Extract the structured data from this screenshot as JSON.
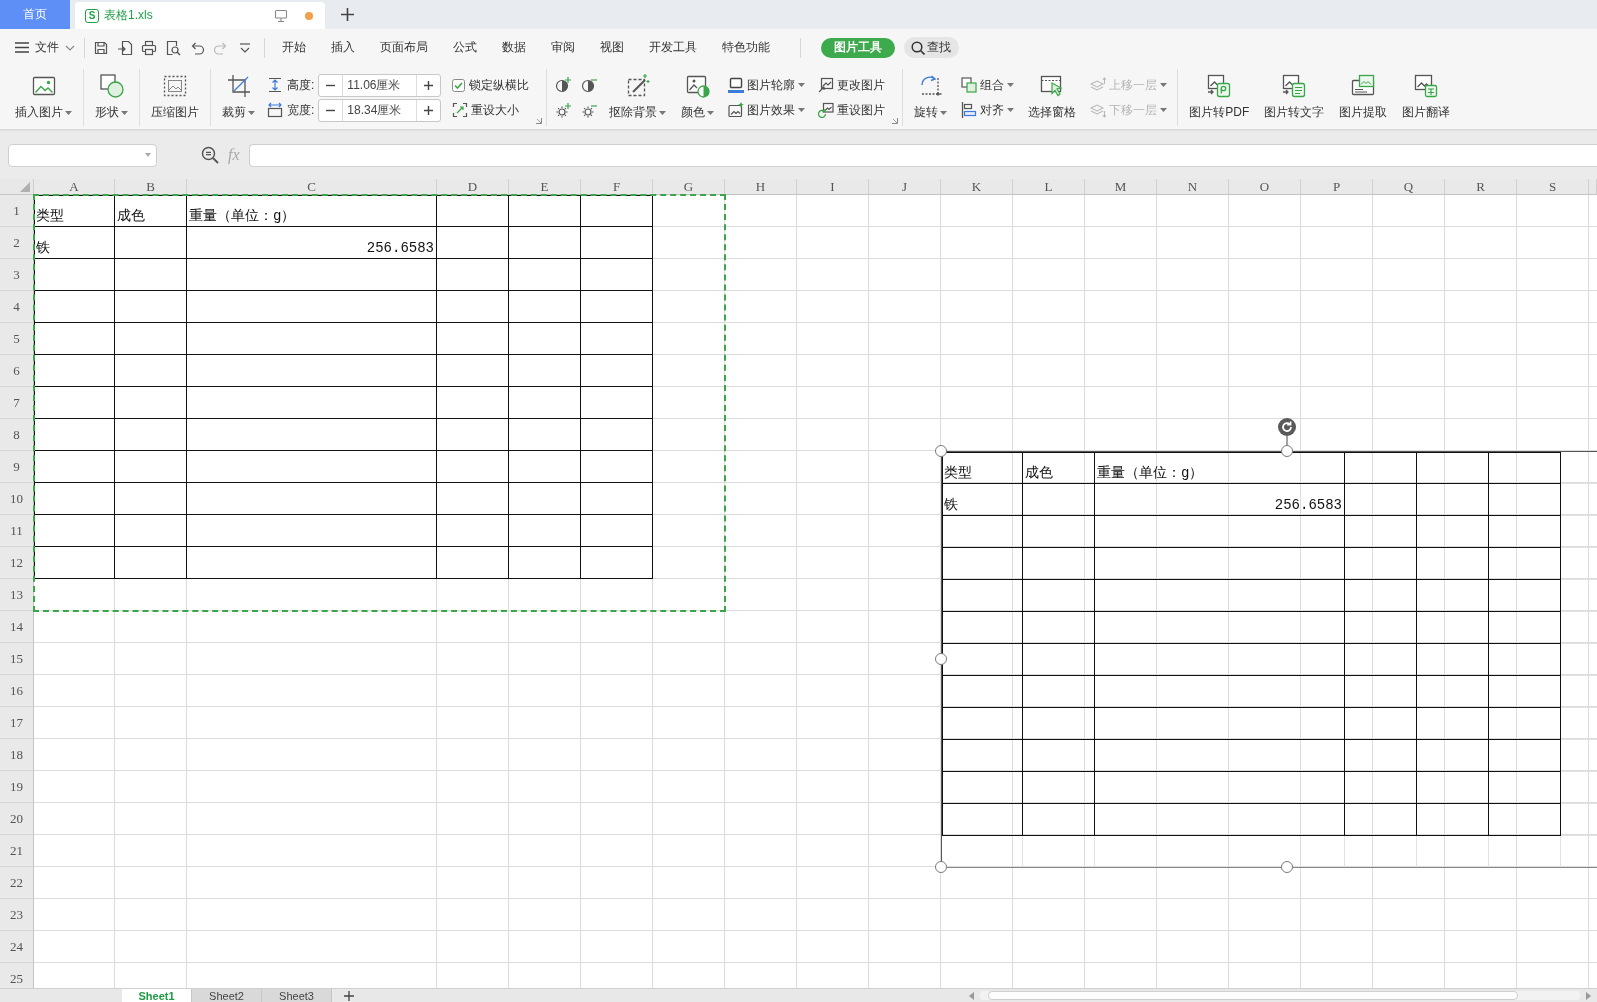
{
  "window_tabs": [
    {
      "kind": "home",
      "label": "首页",
      "selected": false
    },
    {
      "kind": "document",
      "logo": "S",
      "label": "表格1.xls",
      "selected": true,
      "unsaved": true
    }
  ],
  "menu": {
    "file": "文件",
    "quick_access": [
      {
        "disabled": false
      },
      {
        "disabled": false
      },
      {
        "disabled": false
      },
      {
        "disabled": false
      },
      {
        "disabled": false
      },
      {
        "disabled": true
      },
      {
        "disabled": false
      }
    ],
    "tabs": [
      {
        "kind": "standard",
        "label": "开始",
        "selected": false
      },
      {
        "kind": "standard",
        "label": "插入",
        "selected": false
      },
      {
        "kind": "standard",
        "label": "页面布局",
        "selected": false
      },
      {
        "kind": "standard",
        "label": "公式",
        "selected": false
      },
      {
        "kind": "standard",
        "label": "数据",
        "selected": false
      },
      {
        "kind": "standard",
        "label": "审阅",
        "selected": false
      },
      {
        "kind": "standard",
        "label": "视图",
        "selected": false
      },
      {
        "kind": "standard",
        "label": "开发工具",
        "selected": false
      },
      {
        "kind": "standard",
        "label": "特色功能",
        "selected": false
      },
      {
        "kind": "contextual",
        "label": "图片工具",
        "selected": true
      }
    ],
    "search": "查找"
  },
  "ribbon": [
    {
      "items": [
        {
          "kind": "large",
          "label": "插入图片",
          "dropdown": true,
          "disabled": false
        }
      ]
    },
    {
      "items": [
        {
          "kind": "large",
          "label": "形状",
          "dropdown": true,
          "disabled": false
        }
      ]
    },
    {
      "items": [
        {
          "kind": "large",
          "label": "压缩图片",
          "dropdown": false,
          "disabled": false
        }
      ]
    },
    {
      "launcher": true,
      "items": [
        {
          "kind": "large",
          "label": "裁剪",
          "dropdown": true,
          "disabled": false
        },
        {
          "kind": "size",
          "fields": [
            {
              "label": "高度:",
              "value": "11.06厘米"
            },
            {
              "label": "宽度:",
              "value": "18.34厘米"
            }
          ]
        },
        {
          "kind": "stack",
          "entries": [
            {
              "kind": "check",
              "label": "锁定纵横比",
              "checked": true,
              "disabled": false
            },
            {
              "kind": "small",
              "label": "重设大小",
              "dropdown": false,
              "disabled": false
            }
          ]
        }
      ]
    },
    {
      "launcher": true,
      "items": [
        {
          "kind": "icon_grid",
          "buttons": [
            {
              "disabled": false
            },
            {
              "disabled": false
            },
            {
              "disabled": false
            },
            {
              "disabled": false
            }
          ]
        },
        {
          "kind": "large",
          "label": "抠除背景",
          "dropdown": true,
          "disabled": false
        },
        {
          "kind": "large",
          "label": "颜色",
          "dropdown": true,
          "disabled": false
        },
        {
          "kind": "stack",
          "entries": [
            {
              "kind": "small",
              "label": "图片轮廓",
              "dropdown": true,
              "disabled": false
            },
            {
              "kind": "small",
              "label": "图片效果",
              "dropdown": true,
              "disabled": false
            }
          ]
        },
        {
          "kind": "stack",
          "entries": [
            {
              "kind": "small",
              "label": "更改图片",
              "dropdown": false,
              "disabled": false
            },
            {
              "kind": "small",
              "label": "重设图片",
              "dropdown": false,
              "disabled": false
            }
          ]
        }
      ]
    },
    {
      "items": [
        {
          "kind": "large",
          "label": "旋转",
          "dropdown": true,
          "disabled": false
        },
        {
          "kind": "stack",
          "entries": [
            {
              "kind": "small",
              "label": "组合",
              "dropdown": true,
              "disabled": false
            },
            {
              "kind": "small",
              "label": "对齐",
              "dropdown": true,
              "disabled": false
            }
          ]
        },
        {
          "kind": "large",
          "label": "选择窗格",
          "dropdown": false,
          "disabled": false
        },
        {
          "kind": "stack",
          "entries": [
            {
              "kind": "small",
              "label": "上移一层",
              "dropdown": true,
              "disabled": true
            },
            {
              "kind": "small",
              "label": "下移一层",
              "dropdown": true,
              "disabled": true
            }
          ]
        }
      ]
    },
    {
      "items": [
        {
          "kind": "large",
          "label": "图片转PDF",
          "dropdown": false,
          "disabled": false
        },
        {
          "kind": "large",
          "label": "图片转文字",
          "dropdown": false,
          "disabled": false
        },
        {
          "kind": "large",
          "label": "图片提取",
          "dropdown": false,
          "disabled": false
        },
        {
          "kind": "large",
          "label": "图片翻译",
          "dropdown": false,
          "disabled": false
        }
      ]
    }
  ],
  "formula_bar": {
    "function_label": "fx"
  },
  "sheet": {
    "columns": [
      "A",
      "B",
      "C",
      "D",
      "E",
      "F",
      "G",
      "H",
      "I",
      "J",
      "K",
      "L",
      "M",
      "N",
      "O",
      "P",
      "Q",
      "R",
      "S"
    ],
    "rows": [
      "1",
      "2",
      "3",
      "4",
      "5",
      "6",
      "7",
      "8",
      "9",
      "10",
      "11",
      "12",
      "13",
      "14",
      "15",
      "16",
      "17",
      "18",
      "19",
      "20",
      "21",
      "22",
      "23",
      "24",
      "25"
    ],
    "table": {
      "copied": true,
      "rows": [
        {
          "cells": [
            {
              "kind": "text",
              "text": "类型"
            },
            {
              "kind": "text",
              "text": "成色"
            },
            {
              "kind": "text",
              "text": "重量（单位：g）"
            },
            {
              "kind": "blank"
            },
            {
              "kind": "blank"
            },
            {
              "kind": "blank"
            }
          ]
        },
        {
          "cells": [
            {
              "kind": "text",
              "text": "铁"
            },
            {
              "kind": "blank"
            },
            {
              "kind": "number",
              "text": "256.6583"
            },
            {
              "kind": "blank"
            },
            {
              "kind": "blank"
            },
            {
              "kind": "blank"
            }
          ]
        },
        {
          "cells": [
            {
              "kind": "blank"
            },
            {
              "kind": "blank"
            },
            {
              "kind": "blank"
            },
            {
              "kind": "blank"
            },
            {
              "kind": "blank"
            },
            {
              "kind": "blank"
            }
          ]
        },
        {
          "cells": [
            {
              "kind": "blank"
            },
            {
              "kind": "blank"
            },
            {
              "kind": "blank"
            },
            {
              "kind": "blank"
            },
            {
              "kind": "blank"
            },
            {
              "kind": "blank"
            }
          ]
        },
        {
          "cells": [
            {
              "kind": "blank"
            },
            {
              "kind": "blank"
            },
            {
              "kind": "blank"
            },
            {
              "kind": "blank"
            },
            {
              "kind": "blank"
            },
            {
              "kind": "blank"
            }
          ]
        },
        {
          "cells": [
            {
              "kind": "blank"
            },
            {
              "kind": "blank"
            },
            {
              "kind": "blank"
            },
            {
              "kind": "blank"
            },
            {
              "kind": "blank"
            },
            {
              "kind": "blank"
            }
          ]
        },
        {
          "cells": [
            {
              "kind": "blank"
            },
            {
              "kind": "blank"
            },
            {
              "kind": "blank"
            },
            {
              "kind": "blank"
            },
            {
              "kind": "blank"
            },
            {
              "kind": "blank"
            }
          ]
        },
        {
          "cells": [
            {
              "kind": "blank"
            },
            {
              "kind": "blank"
            },
            {
              "kind": "blank"
            },
            {
              "kind": "blank"
            },
            {
              "kind": "blank"
            },
            {
              "kind": "blank"
            }
          ]
        },
        {
          "cells": [
            {
              "kind": "blank"
            },
            {
              "kind": "blank"
            },
            {
              "kind": "blank"
            },
            {
              "kind": "blank"
            },
            {
              "kind": "blank"
            },
            {
              "kind": "blank"
            }
          ]
        },
        {
          "cells": [
            {
              "kind": "blank"
            },
            {
              "kind": "blank"
            },
            {
              "kind": "blank"
            },
            {
              "kind": "blank"
            },
            {
              "kind": "blank"
            },
            {
              "kind": "blank"
            }
          ]
        },
        {
          "cells": [
            {
              "kind": "blank"
            },
            {
              "kind": "blank"
            },
            {
              "kind": "blank"
            },
            {
              "kind": "blank"
            },
            {
              "kind": "blank"
            },
            {
              "kind": "blank"
            }
          ]
        },
        {
          "cells": [
            {
              "kind": "blank"
            },
            {
              "kind": "blank"
            },
            {
              "kind": "blank"
            },
            {
              "kind": "blank"
            },
            {
              "kind": "blank"
            },
            {
              "kind": "blank"
            }
          ]
        }
      ]
    },
    "picture": {
      "selected": true,
      "table": {
        "rows": [
          {
            "cells": [
              {
                "kind": "text",
                "text": "类型"
              },
              {
                "kind": "text",
                "text": "成色"
              },
              {
                "kind": "text",
                "text": "重量（单位：g）"
              },
              {
                "kind": "blank"
              },
              {
                "kind": "blank"
              },
              {
                "kind": "blank"
              }
            ]
          },
          {
            "cells": [
              {
                "kind": "text",
                "text": "铁"
              },
              {
                "kind": "blank"
              },
              {
                "kind": "number",
                "text": "256.6583"
              },
              {
                "kind": "blank"
              },
              {
                "kind": "blank"
              },
              {
                "kind": "blank"
              }
            ]
          },
          {
            "cells": [
              {
                "kind": "blank"
              },
              {
                "kind": "blank"
              },
              {
                "kind": "blank"
              },
              {
                "kind": "blank"
              },
              {
                "kind": "blank"
              },
              {
                "kind": "blank"
              }
            ]
          },
          {
            "cells": [
              {
                "kind": "blank"
              },
              {
                "kind": "blank"
              },
              {
                "kind": "blank"
              },
              {
                "kind": "blank"
              },
              {
                "kind": "blank"
              },
              {
                "kind": "blank"
              }
            ]
          },
          {
            "cells": [
              {
                "kind": "blank"
              },
              {
                "kind": "blank"
              },
              {
                "kind": "blank"
              },
              {
                "kind": "blank"
              },
              {
                "kind": "blank"
              },
              {
                "kind": "blank"
              }
            ]
          },
          {
            "cells": [
              {
                "kind": "blank"
              },
              {
                "kind": "blank"
              },
              {
                "kind": "blank"
              },
              {
                "kind": "blank"
              },
              {
                "kind": "blank"
              },
              {
                "kind": "blank"
              }
            ]
          },
          {
            "cells": [
              {
                "kind": "blank"
              },
              {
                "kind": "blank"
              },
              {
                "kind": "blank"
              },
              {
                "kind": "blank"
              },
              {
                "kind": "blank"
              },
              {
                "kind": "blank"
              }
            ]
          },
          {
            "cells": [
              {
                "kind": "blank"
              },
              {
                "kind": "blank"
              },
              {
                "kind": "blank"
              },
              {
                "kind": "blank"
              },
              {
                "kind": "blank"
              },
              {
                "kind": "blank"
              }
            ]
          },
          {
            "cells": [
              {
                "kind": "blank"
              },
              {
                "kind": "blank"
              },
              {
                "kind": "blank"
              },
              {
                "kind": "blank"
              },
              {
                "kind": "blank"
              },
              {
                "kind": "blank"
              }
            ]
          },
          {
            "cells": [
              {
                "kind": "blank"
              },
              {
                "kind": "blank"
              },
              {
                "kind": "blank"
              },
              {
                "kind": "blank"
              },
              {
                "kind": "blank"
              },
              {
                "kind": "blank"
              }
            ]
          },
          {
            "cells": [
              {
                "kind": "blank"
              },
              {
                "kind": "blank"
              },
              {
                "kind": "blank"
              },
              {
                "kind": "blank"
              },
              {
                "kind": "blank"
              },
              {
                "kind": "blank"
              }
            ]
          },
          {
            "cells": [
              {
                "kind": "blank"
              },
              {
                "kind": "blank"
              },
              {
                "kind": "blank"
              },
              {
                "kind": "blank"
              },
              {
                "kind": "blank"
              },
              {
                "kind": "blank"
              }
            ]
          }
        ]
      }
    }
  },
  "sheet_tabs": [
    {
      "label": "Sheet1",
      "selected": true
    },
    {
      "label": "Sheet2",
      "selected": false
    },
    {
      "label": "Sheet3",
      "selected": false
    }
  ]
}
